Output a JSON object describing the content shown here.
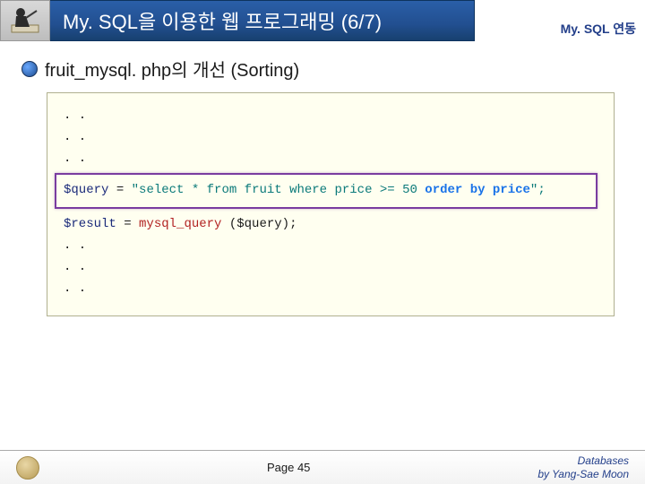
{
  "header": {
    "title": "My. SQL을 이용한 웹 프로그래밍 (6/7)",
    "subtitle": "My. SQL 연동"
  },
  "section": {
    "title": "fruit_mysql. php의 개선 (Sorting)"
  },
  "code": {
    "pre1": ". .",
    "pre2": ". .",
    "pre3": ". .",
    "q_var": "$query",
    "eq1": " = ",
    "q_open": "\"select * from fruit where price >= 50 ",
    "q_order": "order by price",
    "q_close": "\";",
    "r_var": "$result",
    "eq2": " = ",
    "r_func": "mysql_query",
    "r_args": " ($query);",
    "post1": ". .",
    "post2": ". .",
    "post3": ". ."
  },
  "footer": {
    "page": "Page 45",
    "credit": "Databases\nby Yang-Sae Moon"
  }
}
